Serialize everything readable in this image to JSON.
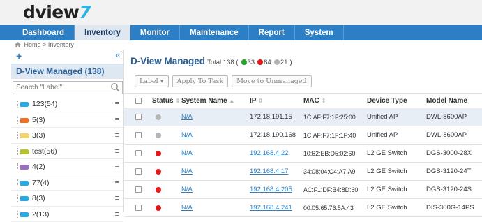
{
  "app": {
    "logo_text": "dview",
    "logo_number": "7"
  },
  "nav": {
    "items": [
      {
        "label": "Dashboard",
        "active": false
      },
      {
        "label": "Inventory",
        "active": true
      },
      {
        "label": "Monitor",
        "active": false
      },
      {
        "label": "Maintenance",
        "active": false
      },
      {
        "label": "Report",
        "active": false
      },
      {
        "label": "System",
        "active": false
      }
    ]
  },
  "breadcrumb": {
    "home": "Home",
    "separator": ">",
    "current": "Inventory"
  },
  "sidebar": {
    "add_icon": "+",
    "collapse_icon": "«",
    "title": "D-View Managed (138)",
    "search_placeholder": "Search \"Label\"",
    "labels": [
      {
        "text": "123(54)",
        "color": "#29a9e1"
      },
      {
        "text": "5(3)",
        "color": "#e8722a"
      },
      {
        "text": "3(3)",
        "color": "#f3d26b"
      },
      {
        "text": "test(56)",
        "color": "#b7c230"
      },
      {
        "text": "4(2)",
        "color": "#9a6fc1"
      },
      {
        "text": "77(4)",
        "color": "#29a9e1"
      },
      {
        "text": "8(3)",
        "color": "#29a9e1"
      },
      {
        "text": "2(13)",
        "color": "#29a9e1"
      }
    ]
  },
  "main": {
    "title": "D-View Managed",
    "total_label": "Total 138 (",
    "counts": {
      "green": "33",
      "red": "84",
      "gray": "21",
      "close": ")"
    },
    "status_colors": {
      "green": "#2ca02c",
      "red": "#e41a1a",
      "gray": "#b5b5b5"
    },
    "buttons": {
      "label": "Label ▾",
      "apply_task": "Apply To Task",
      "move_unmanaged": "Move to Unmanaged"
    },
    "columns": {
      "status": "Status",
      "system_name": "System Name",
      "ip": "IP",
      "mac": "MAC",
      "device_type": "Device Type",
      "model_name": "Model Name"
    },
    "rows": [
      {
        "status": "gray",
        "name": "N/A",
        "ip": "172.18.191.15",
        "ip_link": false,
        "mac": "1C:AF:F7:1F:25:00",
        "type": "Unified AP",
        "model": "DWL-8600AP",
        "selected": true
      },
      {
        "status": "gray",
        "name": "N/A",
        "ip": "172.18.190.168",
        "ip_link": false,
        "mac": "1C:AF:F7:1F:1F:40",
        "type": "Unified AP",
        "model": "DWL-8600AP",
        "selected": false
      },
      {
        "status": "red",
        "name": "N/A",
        "ip": "192.168.4.22",
        "ip_link": true,
        "mac": "10:62:EB:D5:02:60",
        "type": "L2 GE Switch",
        "model": "DGS-3000-28X",
        "selected": false
      },
      {
        "status": "red",
        "name": "N/A",
        "ip": "192.168.4.17",
        "ip_link": true,
        "mac": "34:08:04:C4:A7:A9",
        "type": "L2 GE Switch",
        "model": "DGS-3120-24T",
        "selected": false
      },
      {
        "status": "red",
        "name": "N/A",
        "ip": "192.168.4.205",
        "ip_link": true,
        "mac": "AC:F1:DF:B4:8D:60",
        "type": "L2 GE Switch",
        "model": "DGS-3120-24S",
        "selected": false
      },
      {
        "status": "red",
        "name": "N/A",
        "ip": "192.168.4.241",
        "ip_link": true,
        "mac": "00:05:65:76:5A:43",
        "type": "L2 GE Switch",
        "model": "DIS-300G-14PS",
        "selected": false
      }
    ]
  }
}
